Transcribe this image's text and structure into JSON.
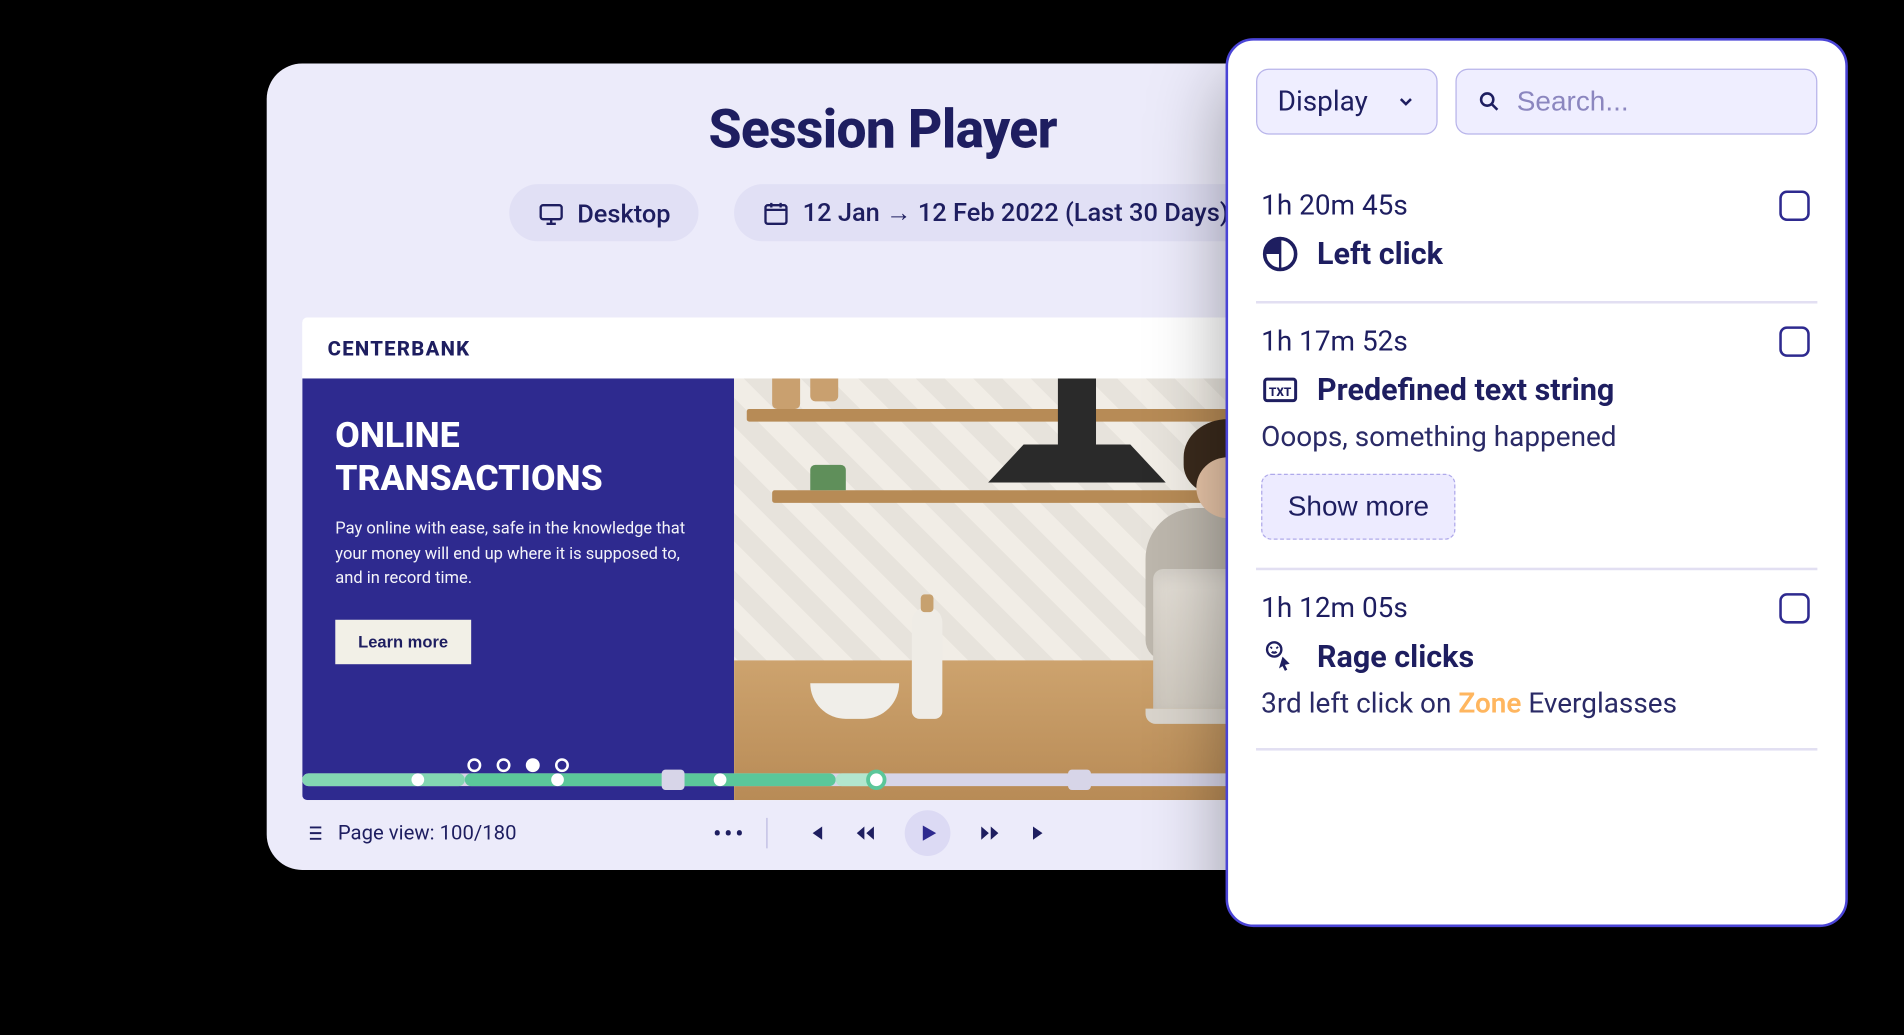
{
  "player": {
    "title": "Session Player",
    "device_label": "Desktop",
    "date_range_label": "12 Jan → 12 Feb 2022 (Last 30 Days)"
  },
  "recording": {
    "brand": "CENTERBANK",
    "hero_title_line1": "ONLINE",
    "hero_title_line2": "TRANSACTIONS",
    "hero_body": "Pay online with ease, safe in the knowledge that your money will end up where it is supposed to, and in record time.",
    "learn_more_label": "Learn more"
  },
  "footer": {
    "page_view_label": "Page view: 100/180"
  },
  "events_panel": {
    "display_label": "Display",
    "search_placeholder": "Search...",
    "items": [
      {
        "time": "1h 20m 45s",
        "title": "Left click"
      },
      {
        "time": "1h 17m 52s",
        "title": "Predefined text string",
        "desc_plain": "Ooops, something happened",
        "show_more_label": "Show more"
      },
      {
        "time": "1h 12m 05s",
        "title": "Rage clicks",
        "desc_prefix": "3rd left click on ",
        "desc_zone": "Zone",
        "desc_suffix": " Everglasses"
      }
    ]
  }
}
